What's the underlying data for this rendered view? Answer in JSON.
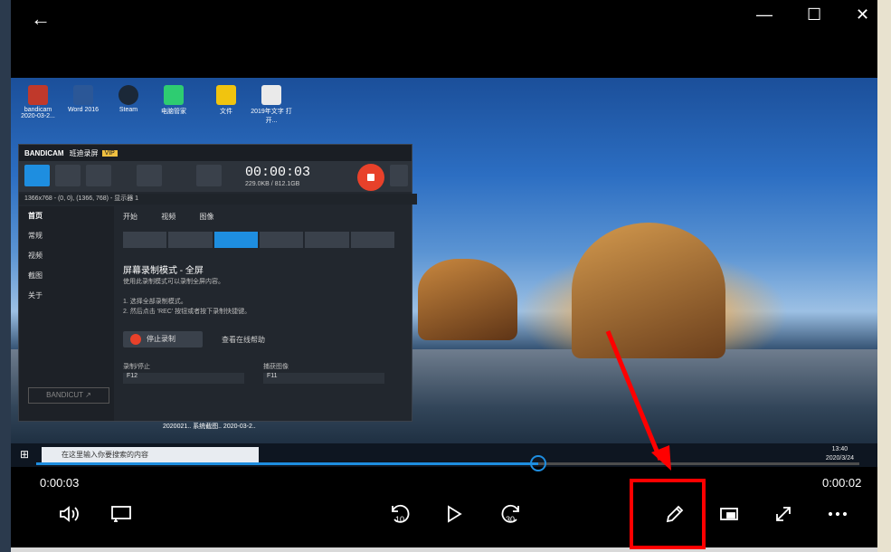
{
  "player": {
    "current_time": "0:00:03",
    "remaining_time": "0:00:02",
    "progress": 0.61
  },
  "desktop": {
    "icons": [
      {
        "label": "bandicam 2020-03-2..."
      },
      {
        "label": "Word 2016"
      },
      {
        "label": "Steam"
      },
      {
        "label": "电脑管家"
      },
      {
        "label": "文件"
      },
      {
        "label": "2019年文字 打开..."
      }
    ],
    "folder_label": "2020021..  系统截图..  2020-03-2..",
    "taskbar": {
      "search_placeholder": "在这里输入你要搜索的内容",
      "clock_time": "13:40",
      "clock_date": "2020/3/24"
    }
  },
  "bandicam": {
    "logo": "BANDICAM",
    "subtitle": "班迪录屏",
    "vip": "VIP",
    "timer": "00:00:03",
    "size": "229.0KB / 812.1GB",
    "resolution": "1366x768 - (0, 0), (1366, 768) - 显示器 1",
    "sidebar": [
      {
        "label": "首页"
      },
      {
        "label": "常规"
      },
      {
        "label": "视频"
      },
      {
        "label": "截图"
      },
      {
        "label": "关于"
      }
    ],
    "tabs": [
      "开始",
      "视频",
      "图像"
    ],
    "mode_title": "屏幕录制模式 - 全屏",
    "mode_desc": "使用此录制模式可以录制全屏内容。",
    "step1": "1. 选择全部录制模式。",
    "step2": "2. 然后点击 'REC' 按钮或者按下录制快捷键。",
    "stop_label": "停止录制",
    "help_label": "查看在线帮助",
    "hotkey1_label": "录制/停止",
    "hotkey1_value": "F12",
    "hotkey2_label": "捕获图像",
    "hotkey2_value": "F11",
    "bandicut": "BANDICUT ↗"
  },
  "colors": {
    "accent": "#1e8ee0",
    "highlight": "#ff0000",
    "arrow": "#ff0000"
  }
}
